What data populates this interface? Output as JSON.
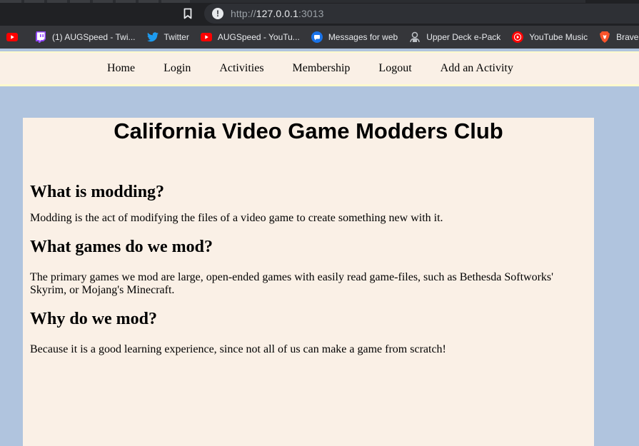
{
  "browser": {
    "url_scheme": "http://",
    "url_host": "127.0.0.1",
    "url_port": ":3013",
    "bookmarks": [
      {
        "label": "",
        "icon": "youtube-icon"
      },
      {
        "label": "(1) AUGSpeed - Twi...",
        "icon": "twitch-icon"
      },
      {
        "label": "Twitter",
        "icon": "twitter-icon"
      },
      {
        "label": "AUGSpeed - YouTu...",
        "icon": "youtube-icon"
      },
      {
        "label": "Messages for web",
        "icon": "messages-icon"
      },
      {
        "label": "Upper Deck e-Pack",
        "icon": "upper-deck-icon"
      },
      {
        "label": "YouTube Music",
        "icon": "youtube-music-icon"
      },
      {
        "label": "Brave Rew",
        "icon": "brave-icon"
      }
    ]
  },
  "nav": {
    "items": [
      "Home",
      "Login",
      "Activities",
      "Membership",
      "Logout",
      "Add an Activity"
    ]
  },
  "main": {
    "title": "California Video Game Modders Club",
    "sections": [
      {
        "heading": "What is modding?",
        "body": "Modding is the act of modifying the files of a video game to create something new with it."
      },
      {
        "heading": "What games do we mod?",
        "body": "The primary games we mod are large, open-ended games with easily read game-files, such as Bethesda Softworks' Skyrim, or Mojang's Minecraft."
      },
      {
        "heading": "Why do we mod?",
        "body": "Because it is a good learning experience, since not all of us can make a game from scratch!"
      }
    ]
  },
  "colors": {
    "page_background": "#b0c4de",
    "panel_background": "#faf0e6",
    "nav_border": "#fffacd",
    "browser_dark": "#202124",
    "bookmarks_bar": "#35363a"
  }
}
